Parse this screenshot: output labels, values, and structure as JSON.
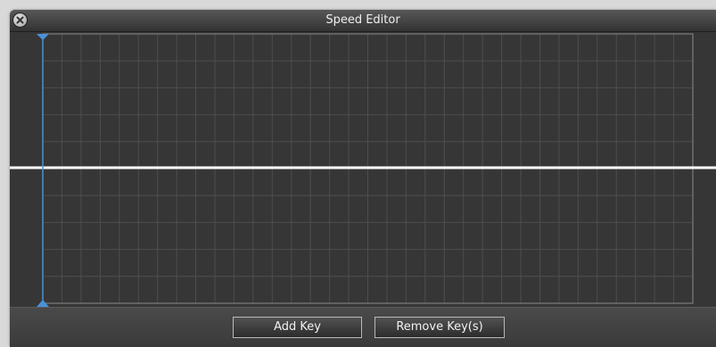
{
  "window": {
    "title": "Speed Editor"
  },
  "editor": {
    "grid_color": "#4e4e4e",
    "border_color": "#8a8a8a",
    "playhead_color": "#4a90d9",
    "speed_line_color": "#ffffff"
  },
  "buttons": {
    "add_key": "Add Key",
    "remove_keys": "Remove Key(s)"
  },
  "icons": {
    "close": "close-icon"
  }
}
